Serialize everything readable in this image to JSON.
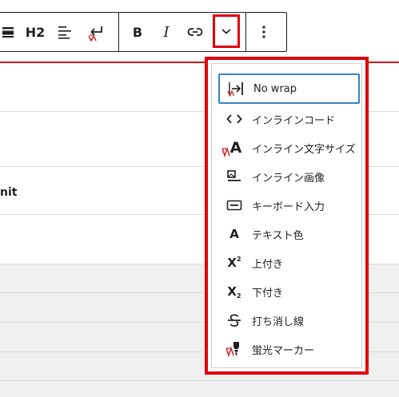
{
  "toolbar": {
    "heading_label": "H2",
    "bold_label": "B",
    "italic_label": "I"
  },
  "table": {
    "cell_text": "nit"
  },
  "menu": {
    "items": [
      {
        "label": "No wrap",
        "icon": "no-wrap-icon"
      },
      {
        "label": "インラインコード",
        "icon": "code-icon"
      },
      {
        "label": "インライン文字サイズ",
        "icon": "font-size-icon"
      },
      {
        "label": "インライン画像",
        "icon": "inline-image-icon"
      },
      {
        "label": "キーボード入力",
        "icon": "keyboard-icon"
      },
      {
        "label": "テキスト色",
        "icon": "text-color-icon"
      },
      {
        "label": "上付き",
        "icon": "superscript-icon"
      },
      {
        "label": "下付き",
        "icon": "subscript-icon"
      },
      {
        "label": "打ち消し線",
        "icon": "strikethrough-icon"
      },
      {
        "label": "蛍光マーカー",
        "icon": "highlighter-icon"
      }
    ],
    "glyphs": {
      "text_color": "A",
      "font_size": "A",
      "sup": "X",
      "sup_small": "2",
      "sub": "X",
      "sub_small": "2"
    }
  },
  "colors": {
    "highlight_red": "#e0000b",
    "focus_blue": "#3582c4",
    "text": "#1e1e1e"
  }
}
